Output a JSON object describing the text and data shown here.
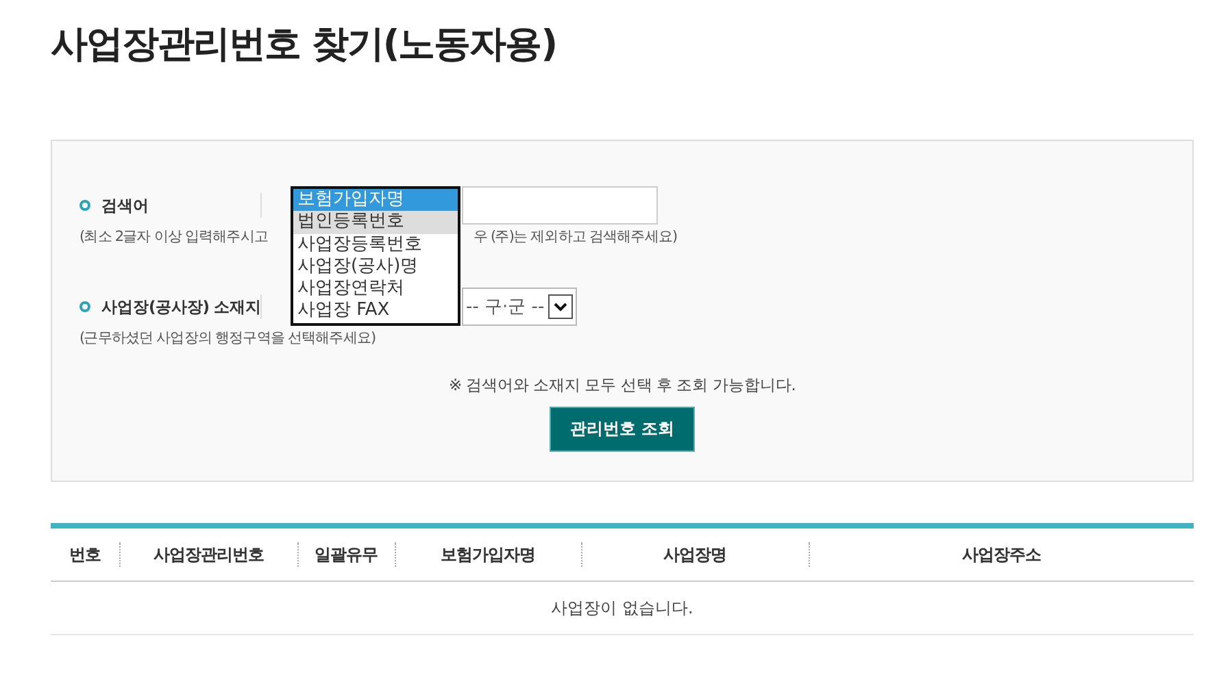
{
  "title": "사업장관리번호 찾기(노동자용)",
  "search": {
    "label": "검색어",
    "hint_start": "(최소 2글자 이상 입력해주시고",
    "hint_end": "우 (주)는 제외하고 검색해주세요)",
    "dropdown": [
      {
        "label": "보험가입자명",
        "selected": true,
        "hovered": false
      },
      {
        "label": "법인등록번호",
        "selected": false,
        "hovered": true
      },
      {
        "label": "사업장등록번호",
        "selected": false,
        "hovered": false
      },
      {
        "label": "사업장(공사)명",
        "selected": false,
        "hovered": false
      },
      {
        "label": "사업장연락처",
        "selected": false,
        "hovered": false
      },
      {
        "label": "사업장 FAX",
        "selected": false,
        "hovered": false
      }
    ]
  },
  "location": {
    "label": "사업장(공사장) 소재지",
    "hint": "(근무하셨던 사업장의 행정구역을 선택해주세요)",
    "district_select": "-- 구·군 --"
  },
  "notice": "※ 검색어와 소재지 모두 선택 후 조회 가능합니다.",
  "button": "관리번호 조회",
  "table": {
    "columns": [
      "번호",
      "사업장관리번호",
      "일괄유무",
      "보험가입자명",
      "사업장명",
      "사업장주소"
    ],
    "empty_message": "사업장이 없습니다."
  }
}
